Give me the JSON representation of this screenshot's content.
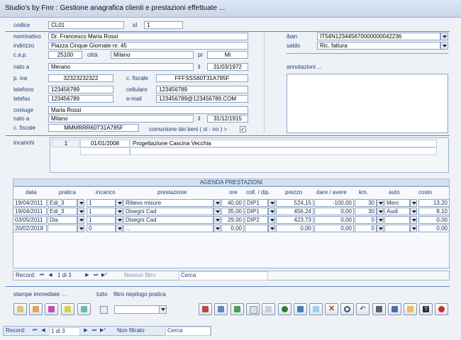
{
  "window": {
    "title": "Studio's by Fmr : Gestione anagrafica clienti e prestazioni effettuate ..."
  },
  "client": {
    "codice_label": "codice",
    "codice": "CL01",
    "id_label": "id",
    "id": "1",
    "nominativo_label": "nominativo",
    "nominativo": "Dr. Francesco Maria Rossi",
    "indirizzo_label": "indirizzo",
    "indirizzo": "Piazza Cinque Giornate nr. 45",
    "cap_label": "c.a.p.",
    "cap": "25100",
    "citta_label": "città",
    "citta": "Milano",
    "pr_label": "pr",
    "pr": "Mi",
    "nato_label": "nato a",
    "nato": "Merano",
    "il_label": "il",
    "il": "31/03/1972",
    "piva_label": "p. iva",
    "piva": "32323232322",
    "cf_label": "c. fiscale",
    "cf": "FFFSSS60T31A785F",
    "telefono_label": "telefono",
    "telefono": "123456789",
    "cellulare_label": "cellulare",
    "cellulare": "123456789",
    "telefax_label": "telefax",
    "telefax": "123456789",
    "email_label": "e-mail",
    "email": "123456789@123456789.COM",
    "coniuge_label": "coniuge",
    "coniuge": "Maria Rossi",
    "coniuge_nato_label": "nato a",
    "coniuge_nato": "Milano",
    "coniuge_il_label": "il",
    "coniuge_il": "31/12/1915",
    "coniuge_cf_label": "c. fiscale",
    "coniuge_cf": "MMMRRR60T31A785F",
    "comunione_label": "comunione dei beni ( si - no )  >",
    "comunione_checked": "✓",
    "iban_label": "iban",
    "iban": "IT54N123445670000000042236",
    "saldo_label": "saldo",
    "saldo": "Ric. fattura",
    "annotazioni_label": "annotazioni ..."
  },
  "incarichi": {
    "label": "incarichi",
    "rows": [
      {
        "n": "1",
        "data": "01/01/2008",
        "descr": "Progettazione Cascina Vecchia"
      }
    ]
  },
  "agenda": {
    "title": "AGENDA PRESTAZIONI",
    "columns": [
      "data",
      "pratica",
      "incarico",
      "prestazione",
      "ore",
      "coll. / dip.",
      "prezzo",
      "dare / avere",
      "km.",
      "auto",
      "costo"
    ],
    "rows": [
      {
        "data": "19/04/2011",
        "pratica": "Edi_3",
        "incarico": "1",
        "prestazione": "Rilievo misure",
        "ore": "40,00",
        "coll": "DIP1",
        "prezzo": "524,15",
        "dare": "-100,00",
        "km": "30",
        "auto": "Merc",
        "costo": "13,20"
      },
      {
        "data": "19/04/2011",
        "pratica": "Edi_3",
        "incarico": "1",
        "prestazione": "Disegni Cad",
        "ore": "35,00",
        "coll": "DIP1",
        "prezzo": "456,24",
        "dare": "0,00",
        "km": "30",
        "auto": "Audi",
        "costo": "8,10"
      },
      {
        "data": "03/05/2011",
        "pratica": "Dia",
        "incarico": "1",
        "prestazione": "Disegni Cad",
        "ore": "29,00",
        "coll": "DIP2",
        "prezzo": "423,73",
        "dare": "0,00",
        "km": "0",
        "auto": "",
        "costo": "0,00"
      },
      {
        "data": "20/02/2018",
        "pratica": "",
        "incarico": "0",
        "prestazione": "...",
        "ore": "0,00",
        "coll": "",
        "prezzo": "0,00",
        "dare": "0,00",
        "km": "0",
        "auto": "",
        "costo": "0,00"
      }
    ],
    "nav": {
      "record_label": "Record:",
      "position": "1 di 3",
      "filter": "Nessun filtro",
      "search": "Cerca"
    }
  },
  "bottom": {
    "stampe_label": "stampe immediate ...",
    "tutto_label": "tutto",
    "filtro_label": "filtro riepilogo pratica"
  },
  "status": {
    "record_label": "Record:",
    "position": "1 di 3",
    "filter": "Non filtrato",
    "search": "Cerca"
  },
  "colors": {
    "accent": "#1e3f78",
    "separator": "#5e86c0",
    "delete": "#cc2a2a",
    "save": "#2e7d32"
  }
}
